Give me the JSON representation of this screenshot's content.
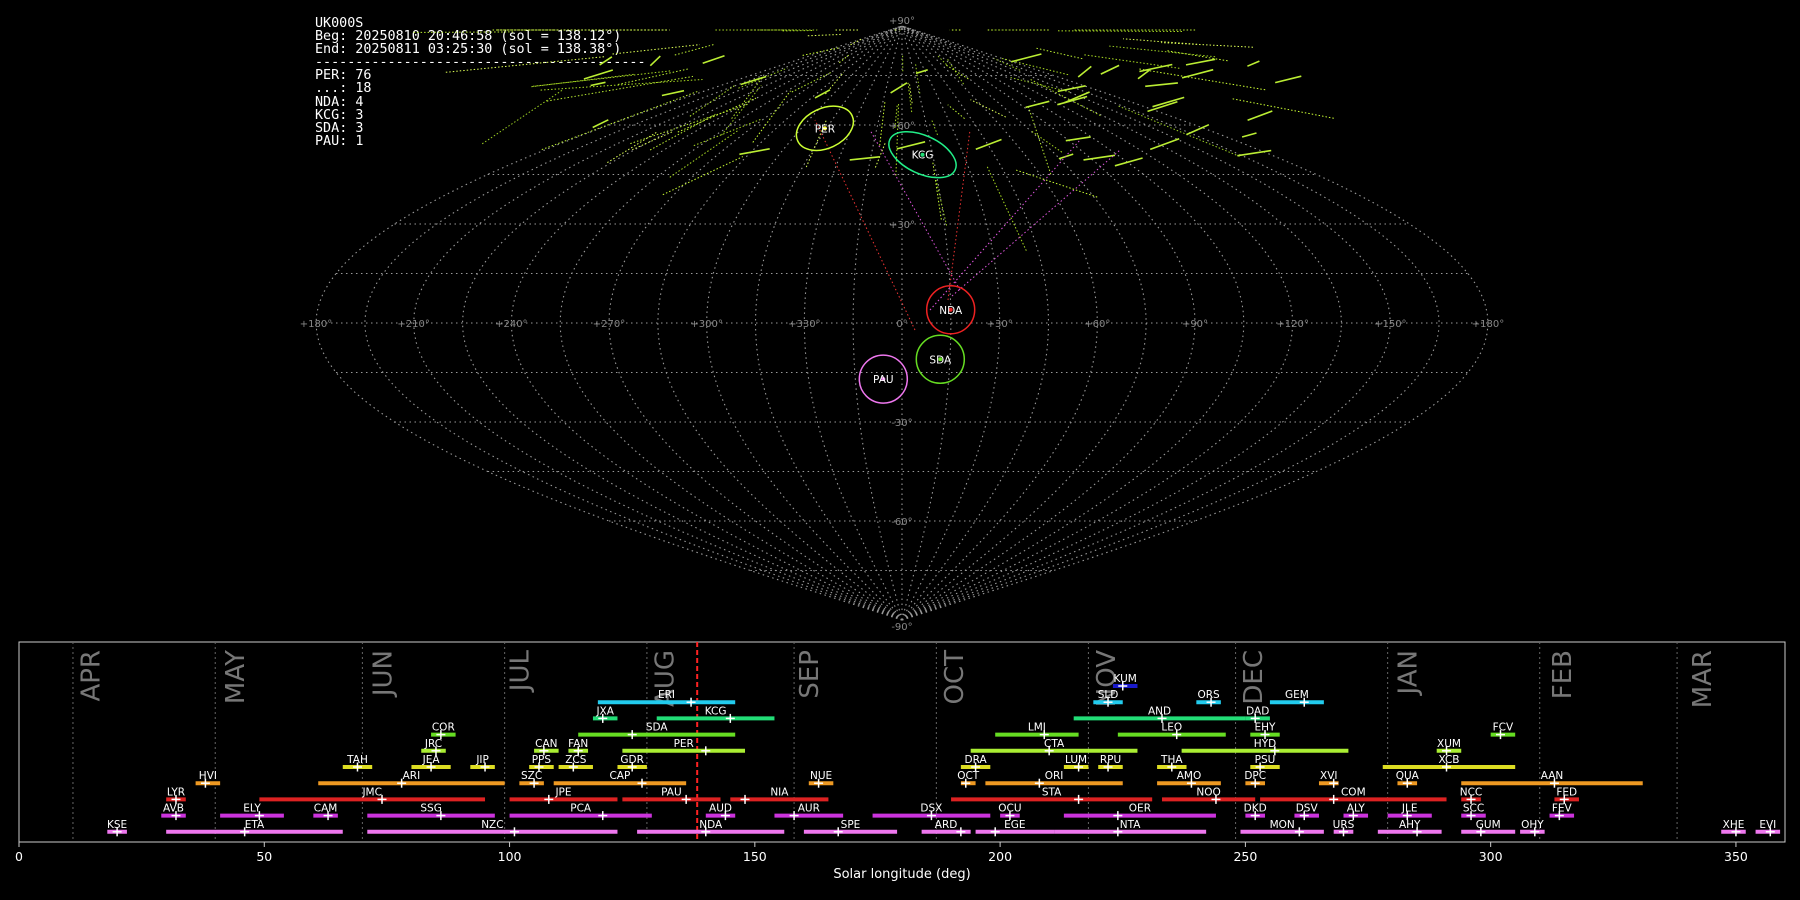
{
  "header": {
    "station": "UK000S",
    "begin": "Beg: 20250810 20:46:58 (sol = 138.12°)",
    "end": "End: 20250811 03:25:30 (sol = 138.38°)",
    "separator": "-----------------------------------------",
    "counts": [
      {
        "code": "PER",
        "n": 76
      },
      {
        "code": "...",
        "n": 18
      },
      {
        "code": "NDA",
        "n": 4
      },
      {
        "code": "KCG",
        "n": 3
      },
      {
        "code": "SDA",
        "n": 3
      },
      {
        "code": "PAU",
        "n": 1
      }
    ]
  },
  "chart_data": [
    {
      "type": "scatter",
      "projection": "sinusoidal",
      "lon_ticks": [
        "+180°",
        "+150°",
        "+120°",
        "+90°",
        "+60°",
        "+30°",
        "0°",
        "+330°",
        "+300°",
        "+270°",
        "+240°",
        "+210°",
        "+180°"
      ],
      "lat_ticks": [
        "+90°",
        "+60°",
        "+30°",
        "-30°",
        "-60°",
        "-90°"
      ],
      "grid": true,
      "radiants": [
        {
          "code": "PER",
          "lon": 46,
          "lat": 59,
          "color": "#ffff44",
          "ring": "#ccff33",
          "meteors": 76
        },
        {
          "code": "KCG",
          "lon": 350,
          "lat": 51,
          "color": "#22dd77",
          "ring": "#22ee88",
          "meteors": 3
        },
        {
          "code": "NDA",
          "lon": 345,
          "lat": 4,
          "color": "#ee2222",
          "ring": "#ee2222",
          "meteors": 4
        },
        {
          "code": "SDA",
          "lon": 348,
          "lat": -11,
          "color": "#66dd22",
          "ring": "#66dd22",
          "meteors": 3
        },
        {
          "code": "PAU",
          "lon": 6,
          "lat": -17,
          "color": "#ee77ee",
          "ring": "#ee77ee",
          "meteors": 1
        }
      ]
    },
    {
      "type": "gantt",
      "xlabel": "Solar longitude (deg)",
      "xlim": [
        0,
        360
      ],
      "xticks": [
        0,
        50,
        100,
        150,
        200,
        250,
        300,
        350
      ],
      "current_sol": 138.25,
      "months": [
        {
          "name": "APR",
          "sol": 11.5
        },
        {
          "name": "MAY",
          "sol": 41
        },
        {
          "name": "JUN",
          "sol": 71
        },
        {
          "name": "JUL",
          "sol": 99
        },
        {
          "name": "AUG",
          "sol": 128.5
        },
        {
          "name": "SEP",
          "sol": 158
        },
        {
          "name": "OCT",
          "sol": 187.5
        },
        {
          "name": "NOV",
          "sol": 218.5
        },
        {
          "name": "DEC",
          "sol": 248.5
        },
        {
          "name": "JAN",
          "sol": 280
        },
        {
          "name": "FEB",
          "sol": 311.5
        },
        {
          "name": "MAR",
          "sol": 340
        }
      ],
      "showers": [
        {
          "code": "KUM",
          "row": 0,
          "start": 223,
          "end": 228,
          "peak": 225,
          "color": "#1a1acc"
        },
        {
          "code": "ERI",
          "row": 1,
          "start": 118,
          "end": 146,
          "peak": 137,
          "color": "#22ccee"
        },
        {
          "code": "SLD",
          "row": 1,
          "start": 219,
          "end": 225,
          "peak": 222,
          "color": "#22ccee"
        },
        {
          "code": "ORS",
          "row": 1,
          "start": 240,
          "end": 245,
          "peak": 243,
          "color": "#22ccee"
        },
        {
          "code": "GEM",
          "row": 1,
          "start": 255,
          "end": 266,
          "peak": 262,
          "color": "#22ccee"
        },
        {
          "code": "JXA",
          "row": 2,
          "start": 117,
          "end": 122,
          "peak": 119,
          "color": "#22dd77"
        },
        {
          "code": "KCG",
          "row": 2,
          "start": 130,
          "end": 154,
          "peak": 145,
          "color": "#22dd77"
        },
        {
          "code": "AND",
          "row": 2,
          "start": 215,
          "end": 250,
          "peak": 233,
          "color": "#22dd77"
        },
        {
          "code": "DAD",
          "row": 2,
          "start": 250,
          "end": 255,
          "peak": 252,
          "color": "#22dd77"
        },
        {
          "code": "COR",
          "row": 3,
          "start": 84,
          "end": 89,
          "peak": 86,
          "color": "#66dd22"
        },
        {
          "code": "SDA",
          "row": 3,
          "start": 114,
          "end": 146,
          "peak": 125,
          "color": "#66dd22"
        },
        {
          "code": "LMI",
          "row": 3,
          "start": 199,
          "end": 216,
          "peak": 209,
          "color": "#66dd22"
        },
        {
          "code": "LEO",
          "row": 3,
          "start": 224,
          "end": 246,
          "peak": 236,
          "color": "#66dd22"
        },
        {
          "code": "EHY",
          "row": 3,
          "start": 251,
          "end": 257,
          "peak": 254,
          "color": "#66dd22"
        },
        {
          "code": "FCV",
          "row": 3,
          "start": 300,
          "end": 305,
          "peak": 302,
          "color": "#66dd22"
        },
        {
          "code": "JRC",
          "row": 4,
          "start": 82,
          "end": 87,
          "peak": 85,
          "color": "#aaee33"
        },
        {
          "code": "CAN",
          "row": 4,
          "start": 105,
          "end": 110,
          "peak": 107,
          "color": "#aaee33"
        },
        {
          "code": "FAN",
          "row": 4,
          "start": 112,
          "end": 116,
          "peak": 114,
          "color": "#aaee33"
        },
        {
          "code": "PER",
          "row": 4,
          "start": 123,
          "end": 148,
          "peak": 140,
          "color": "#aaee33"
        },
        {
          "code": "CTA",
          "row": 4,
          "start": 194,
          "end": 228,
          "peak": 210,
          "color": "#aaee33"
        },
        {
          "code": "HYD",
          "row": 4,
          "start": 237,
          "end": 271,
          "peak": 256,
          "color": "#aaee33"
        },
        {
          "code": "XUM",
          "row": 4,
          "start": 289,
          "end": 294,
          "peak": 291,
          "color": "#aaee33"
        },
        {
          "code": "TAH",
          "row": 5,
          "start": 66,
          "end": 72,
          "peak": 69,
          "color": "#dddd22"
        },
        {
          "code": "JEA",
          "row": 5,
          "start": 80,
          "end": 88,
          "peak": 84,
          "color": "#dddd22"
        },
        {
          "code": "JIP",
          "row": 5,
          "start": 92,
          "end": 97,
          "peak": 95,
          "color": "#dddd22"
        },
        {
          "code": "PPS",
          "row": 5,
          "start": 104,
          "end": 109,
          "peak": 106,
          "color": "#dddd22"
        },
        {
          "code": "ZCS",
          "row": 5,
          "start": 110,
          "end": 117,
          "peak": 113,
          "color": "#dddd22"
        },
        {
          "code": "GDR",
          "row": 5,
          "start": 122,
          "end": 128,
          "peak": 125,
          "color": "#dddd22"
        },
        {
          "code": "DRA",
          "row": 5,
          "start": 192,
          "end": 198,
          "peak": 195,
          "color": "#dddd22"
        },
        {
          "code": "LUM",
          "row": 5,
          "start": 213,
          "end": 218,
          "peak": 216,
          "color": "#dddd22"
        },
        {
          "code": "RPU",
          "row": 5,
          "start": 220,
          "end": 225,
          "peak": 222,
          "color": "#dddd22"
        },
        {
          "code": "THA",
          "row": 5,
          "start": 232,
          "end": 238,
          "peak": 235,
          "color": "#dddd22"
        },
        {
          "code": "PSU",
          "row": 5,
          "start": 251,
          "end": 257,
          "peak": 253,
          "color": "#dddd22"
        },
        {
          "code": "XCB",
          "row": 5,
          "start": 278,
          "end": 305,
          "peak": 291,
          "color": "#dddd22"
        },
        {
          "code": "HVI",
          "row": 6,
          "start": 36,
          "end": 41,
          "peak": 38,
          "color": "#ee9922"
        },
        {
          "code": "ARI",
          "row": 6,
          "start": 61,
          "end": 99,
          "peak": 78,
          "color": "#ee9922"
        },
        {
          "code": "SZC",
          "row": 6,
          "start": 102,
          "end": 107,
          "peak": 105,
          "color": "#ee9922"
        },
        {
          "code": "CAP",
          "row": 6,
          "start": 109,
          "end": 136,
          "peak": 127,
          "color": "#ee9922"
        },
        {
          "code": "NUE",
          "row": 6,
          "start": 161,
          "end": 166,
          "peak": 163,
          "color": "#ee9922"
        },
        {
          "code": "OCT",
          "row": 6,
          "start": 192,
          "end": 195,
          "peak": 193,
          "color": "#ee9922"
        },
        {
          "code": "ORI",
          "row": 6,
          "start": 197,
          "end": 225,
          "peak": 208,
          "color": "#ee9922"
        },
        {
          "code": "AMO",
          "row": 6,
          "start": 232,
          "end": 245,
          "peak": 239,
          "color": "#ee9922"
        },
        {
          "code": "DPC",
          "row": 6,
          "start": 250,
          "end": 254,
          "peak": 252,
          "color": "#ee9922"
        },
        {
          "code": "XVI",
          "row": 6,
          "start": 265,
          "end": 269,
          "peak": 268,
          "color": "#ee9922"
        },
        {
          "code": "QUA",
          "row": 6,
          "start": 281,
          "end": 285,
          "peak": 283,
          "color": "#ee9922"
        },
        {
          "code": "AAN",
          "row": 6,
          "start": 294,
          "end": 331,
          "peak": 313,
          "color": "#ee9922"
        },
        {
          "code": "LYR",
          "row": 7,
          "start": 30,
          "end": 34,
          "peak": 32,
          "color": "#dd2222"
        },
        {
          "code": "JMC",
          "row": 7,
          "start": 49,
          "end": 95,
          "peak": 74,
          "color": "#dd2222"
        },
        {
          "code": "JPE",
          "row": 7,
          "start": 100,
          "end": 122,
          "peak": 108,
          "color": "#dd2222"
        },
        {
          "code": "PAU",
          "row": 7,
          "start": 123,
          "end": 143,
          "peak": 136,
          "color": "#dd2222"
        },
        {
          "code": "NIA",
          "row": 7,
          "start": 145,
          "end": 165,
          "peak": 148,
          "color": "#dd2222"
        },
        {
          "code": "STA",
          "row": 7,
          "start": 190,
          "end": 231,
          "peak": 216,
          "color": "#dd2222"
        },
        {
          "code": "NOO",
          "row": 7,
          "start": 233,
          "end": 252,
          "peak": 244,
          "color": "#dd2222"
        },
        {
          "code": "COM",
          "row": 7,
          "start": 253,
          "end": 291,
          "peak": 268,
          "color": "#dd2222"
        },
        {
          "code": "NCC",
          "row": 7,
          "start": 294,
          "end": 298,
          "peak": 296,
          "color": "#dd2222"
        },
        {
          "code": "FED",
          "row": 7,
          "start": 313,
          "end": 318,
          "peak": 315,
          "color": "#dd2222"
        },
        {
          "code": "AVB",
          "row": 8,
          "start": 29,
          "end": 34,
          "peak": 32,
          "color": "#cc33dd"
        },
        {
          "code": "ELY",
          "row": 8,
          "start": 41,
          "end": 54,
          "peak": 49,
          "color": "#cc33dd"
        },
        {
          "code": "CAM",
          "row": 8,
          "start": 60,
          "end": 65,
          "peak": 63,
          "color": "#cc33dd"
        },
        {
          "code": "SSG",
          "row": 8,
          "start": 71,
          "end": 97,
          "peak": 86,
          "color": "#cc33dd"
        },
        {
          "code": "PCA",
          "row": 8,
          "start": 100,
          "end": 129,
          "peak": 119,
          "color": "#cc33dd"
        },
        {
          "code": "AUD",
          "row": 8,
          "start": 140,
          "end": 146,
          "peak": 144,
          "color": "#cc33dd"
        },
        {
          "code": "AUR",
          "row": 8,
          "start": 154,
          "end": 168,
          "peak": 158,
          "color": "#cc33dd"
        },
        {
          "code": "DSX",
          "row": 8,
          "start": 174,
          "end": 198,
          "peak": 186,
          "color": "#cc33dd"
        },
        {
          "code": "OCU",
          "row": 8,
          "start": 200,
          "end": 204,
          "peak": 202,
          "color": "#cc33dd"
        },
        {
          "code": "OER",
          "row": 8,
          "start": 213,
          "end": 244,
          "peak": 224,
          "color": "#cc33dd"
        },
        {
          "code": "DKD",
          "row": 8,
          "start": 250,
          "end": 254,
          "peak": 252,
          "color": "#cc33dd"
        },
        {
          "code": "DSV",
          "row": 8,
          "start": 260,
          "end": 265,
          "peak": 262,
          "color": "#cc33dd"
        },
        {
          "code": "ALY",
          "row": 8,
          "start": 270,
          "end": 275,
          "peak": 272,
          "color": "#cc33dd"
        },
        {
          "code": "JLE",
          "row": 8,
          "start": 279,
          "end": 288,
          "peak": 283,
          "color": "#cc33dd"
        },
        {
          "code": "SCC",
          "row": 8,
          "start": 294,
          "end": 299,
          "peak": 296,
          "color": "#cc33dd"
        },
        {
          "code": "FEV",
          "row": 8,
          "start": 312,
          "end": 317,
          "peak": 314,
          "color": "#cc33dd"
        },
        {
          "code": "KSE",
          "row": 9,
          "start": 18,
          "end": 22,
          "peak": 20,
          "color": "#ee77ee"
        },
        {
          "code": "ETA",
          "row": 9,
          "start": 30,
          "end": 66,
          "peak": 46,
          "color": "#ee77ee"
        },
        {
          "code": "NZC",
          "row": 9,
          "start": 71,
          "end": 122,
          "peak": 101,
          "color": "#ee77ee"
        },
        {
          "code": "NDA",
          "row": 9,
          "start": 126,
          "end": 156,
          "peak": 140,
          "color": "#ee77ee"
        },
        {
          "code": "SPE",
          "row": 9,
          "start": 160,
          "end": 179,
          "peak": 167,
          "color": "#ee77ee"
        },
        {
          "code": "ARD",
          "row": 9,
          "start": 184,
          "end": 194,
          "peak": 192,
          "color": "#ee77ee"
        },
        {
          "code": "EGE",
          "row": 9,
          "start": 195,
          "end": 211,
          "peak": 199,
          "color": "#ee77ee"
        },
        {
          "code": "NTA",
          "row": 9,
          "start": 211,
          "end": 242,
          "peak": 224,
          "color": "#ee77ee"
        },
        {
          "code": "MON",
          "row": 9,
          "start": 249,
          "end": 266,
          "peak": 261,
          "color": "#ee77ee"
        },
        {
          "code": "URS",
          "row": 9,
          "start": 268,
          "end": 272,
          "peak": 270,
          "color": "#ee77ee"
        },
        {
          "code": "AHY",
          "row": 9,
          "start": 277,
          "end": 290,
          "peak": 285,
          "color": "#ee77ee"
        },
        {
          "code": "GUM",
          "row": 9,
          "start": 294,
          "end": 305,
          "peak": 298,
          "color": "#ee77ee"
        },
        {
          "code": "OHY",
          "row": 9,
          "start": 306,
          "end": 311,
          "peak": 309,
          "color": "#ee77ee"
        },
        {
          "code": "XHE",
          "row": 9,
          "start": 347,
          "end": 352,
          "peak": 350,
          "color": "#ee77ee"
        },
        {
          "code": "EVI",
          "row": 9,
          "start": 354,
          "end": 359,
          "peak": 357,
          "color": "#ee77ee"
        }
      ]
    }
  ]
}
